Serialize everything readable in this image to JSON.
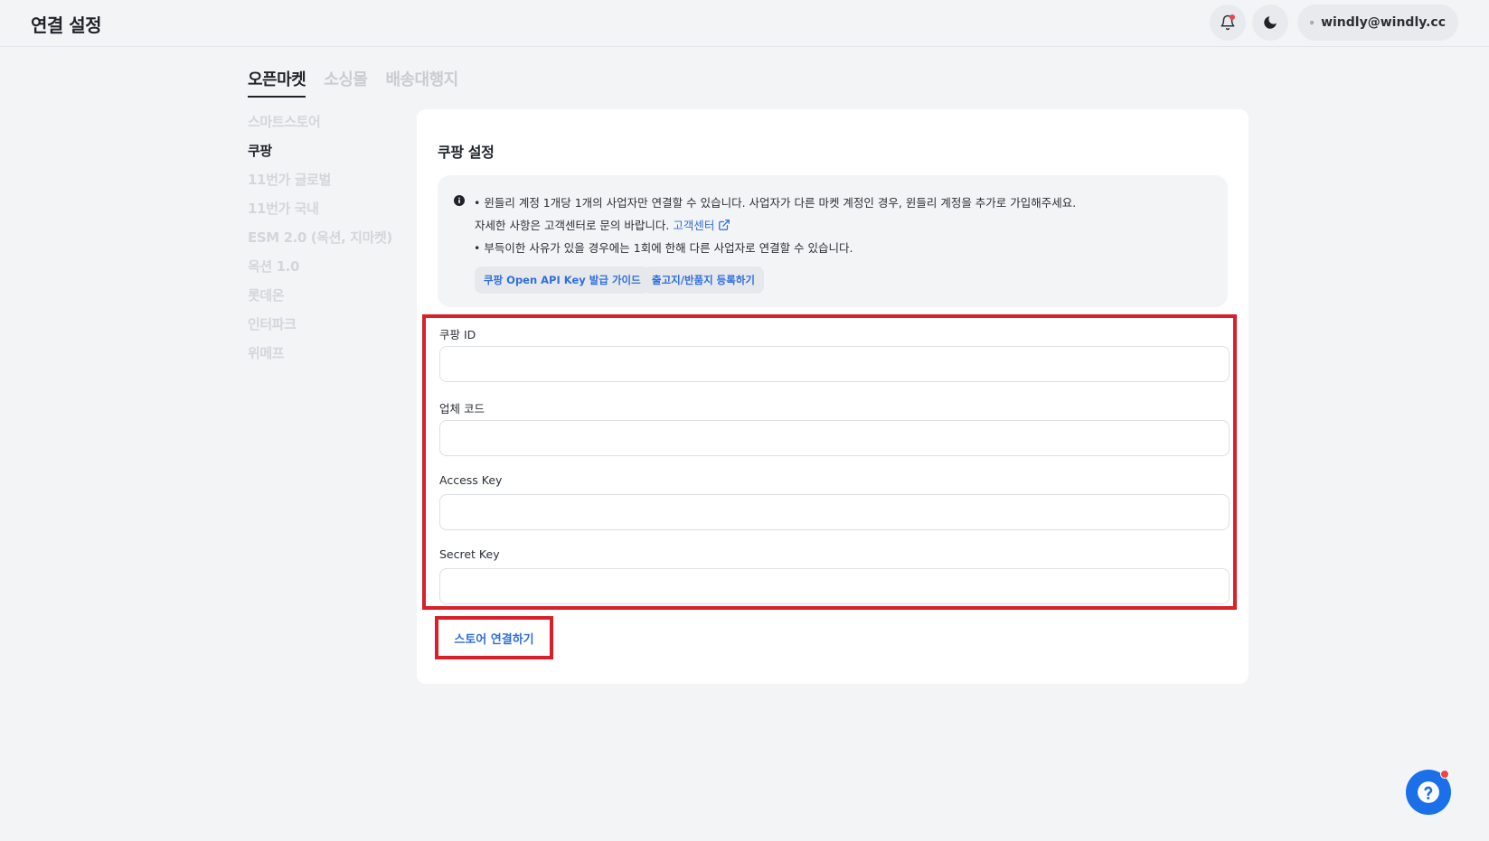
{
  "header": {
    "title": "연결 설정",
    "user_email": "windly@windly.cc"
  },
  "category_tabs": [
    {
      "label": "오픈마켓",
      "active": true
    },
    {
      "label": "소싱몰",
      "active": false
    },
    {
      "label": "배송대행지",
      "active": false
    }
  ],
  "sidebar": {
    "items": [
      {
        "label": "스마트스토어",
        "active": false
      },
      {
        "label": "쿠팡",
        "active": true
      },
      {
        "label": "11번가 글로벌",
        "active": false
      },
      {
        "label": "11번가 국내",
        "active": false
      },
      {
        "label": "ESM 2.0 (옥션, 지마켓)",
        "active": false
      },
      {
        "label": "옥션 1.0",
        "active": false
      },
      {
        "label": "롯데온",
        "active": false
      },
      {
        "label": "인터파크",
        "active": false
      },
      {
        "label": "위메프",
        "active": false
      }
    ]
  },
  "card": {
    "title": "쿠팡 설정",
    "notice": {
      "line1": "• 윈들리 계정 1개당 1개의 사업자만 연결할 수 있습니다. 사업자가 다른 마켓 계정인 경우, 윈들리 계정을 추가로 가입해주세요.",
      "line2": "자세한 사항은 고객센터로 문의 바랍니다.",
      "help_link": "고객센터",
      "line3": "• 부득이한 사유가 있을 경우에는 1회에 한해 다른 사업자로 연결할 수 있습니다.",
      "chip_guide": "쿠팡 Open API Key 발급 가이드",
      "chip_address": "출고지/반품지 등록하기"
    },
    "fields": [
      {
        "label": "쿠팡 ID",
        "value": ""
      },
      {
        "label": "업체 코드",
        "value": ""
      },
      {
        "label": "Access Key",
        "value": ""
      },
      {
        "label": "Secret Key",
        "value": ""
      }
    ],
    "connect_button": "스토어 연결하기"
  },
  "colors": {
    "accent": "#2f6fde",
    "highlight": "#d9202a",
    "background": "#f3f4f6"
  },
  "icons": [
    "bell-icon",
    "moon-icon",
    "user-circle-icon",
    "info-icon",
    "external-link-icon",
    "help-icon"
  ]
}
